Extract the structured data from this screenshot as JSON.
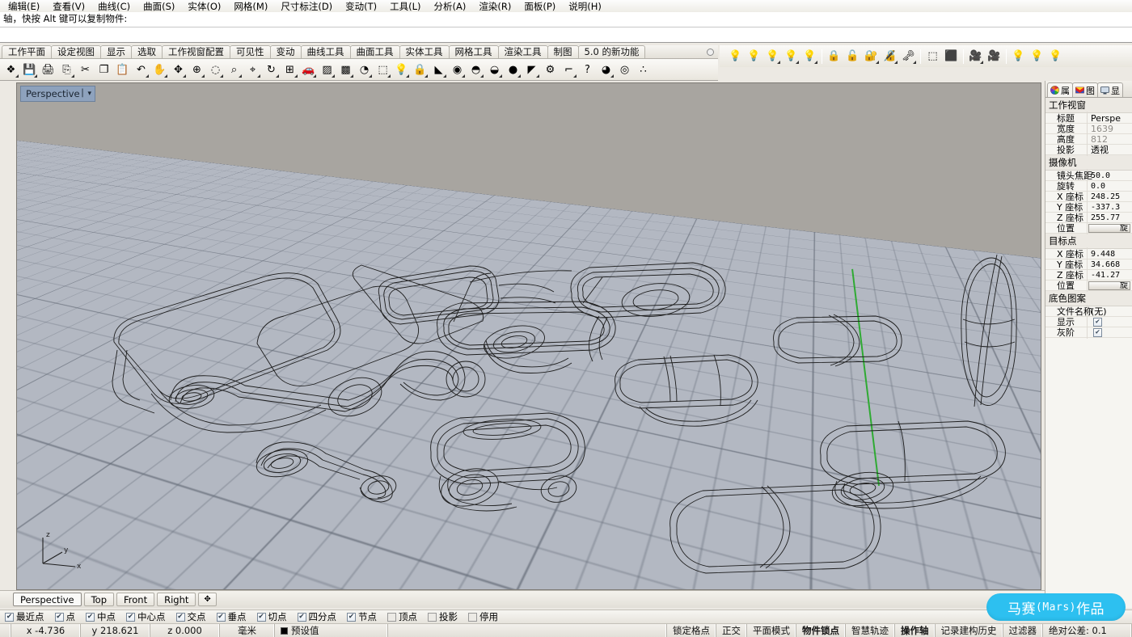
{
  "menu": {
    "items": [
      {
        "label": "编辑(E)"
      },
      {
        "label": "查看(V)"
      },
      {
        "label": "曲线(C)"
      },
      {
        "label": "曲面(S)"
      },
      {
        "label": "实体(O)"
      },
      {
        "label": "网格(M)"
      },
      {
        "label": "尺寸标注(D)"
      },
      {
        "label": "变动(T)"
      },
      {
        "label": "工具(L)"
      },
      {
        "label": "分析(A)"
      },
      {
        "label": "渲染(R)"
      },
      {
        "label": "面板(P)"
      },
      {
        "label": "说明(H)"
      }
    ]
  },
  "command": {
    "history_line": "轴，快按 Alt 键可以复制物件:",
    "input_value": "",
    "placeholder": ""
  },
  "toolbar_tabs": {
    "items": [
      {
        "label": "工作平面",
        "active": false
      },
      {
        "label": "设定视图",
        "active": false
      },
      {
        "label": "显示",
        "active": false
      },
      {
        "label": "选取",
        "active": false
      },
      {
        "label": "工作视窗配置",
        "active": false
      },
      {
        "label": "可见性",
        "active": false
      },
      {
        "label": "变动",
        "active": false
      },
      {
        "label": "曲线工具",
        "active": false
      },
      {
        "label": "曲面工具",
        "active": false
      },
      {
        "label": "实体工具",
        "active": false
      },
      {
        "label": "网格工具",
        "active": false
      },
      {
        "label": "渲染工具",
        "active": false
      },
      {
        "label": "制图",
        "active": false
      },
      {
        "label": "5.0 的新功能",
        "active": false
      }
    ]
  },
  "main_toolbar": {
    "icons": [
      {
        "name": "new-file-icon",
        "glyph": "❖",
        "flyout": true
      },
      {
        "name": "save-icon",
        "glyph": "💾",
        "flyout": true
      },
      {
        "name": "print-icon",
        "glyph": "🖨",
        "flyout": false
      },
      {
        "name": "cut-clipboard-icon",
        "glyph": "⎘",
        "flyout": true
      },
      {
        "name": "scissors-cut-icon",
        "glyph": "✂",
        "flyout": false
      },
      {
        "name": "copy-icon",
        "glyph": "❐",
        "flyout": false
      },
      {
        "name": "paste-icon",
        "glyph": "📋",
        "flyout": false
      },
      {
        "name": "undo-icon",
        "glyph": "↶",
        "flyout": true
      },
      {
        "name": "pan-hand-icon",
        "glyph": "✋",
        "flyout": true
      },
      {
        "name": "move-arrows-icon",
        "glyph": "✥",
        "flyout": true
      },
      {
        "name": "zoom-in-icon",
        "glyph": "⊕",
        "flyout": true
      },
      {
        "name": "zoom-selected-icon",
        "glyph": "◌",
        "flyout": true
      },
      {
        "name": "zoom-window-icon",
        "glyph": "⌕",
        "flyout": true
      },
      {
        "name": "zoom-extents-icon",
        "glyph": "⌖",
        "flyout": true
      },
      {
        "name": "rotate-view-icon",
        "glyph": "↻",
        "flyout": true
      },
      {
        "name": "grid-icon",
        "glyph": "⊞",
        "flyout": true
      },
      {
        "name": "render-car-icon",
        "glyph": "🚗",
        "flyout": true
      },
      {
        "name": "render-preview-icon",
        "glyph": "▨",
        "flyout": true
      },
      {
        "name": "render-props-icon",
        "glyph": "▩",
        "flyout": true
      },
      {
        "name": "analyze-circle-icon",
        "glyph": "◔",
        "flyout": true
      },
      {
        "name": "point-edit-icon",
        "glyph": "⬚",
        "flyout": true
      },
      {
        "name": "light-bulb-icon",
        "glyph": "💡",
        "flyout": true
      },
      {
        "name": "lock-icon",
        "glyph": "🔒",
        "flyout": true
      },
      {
        "name": "layer-color-icon",
        "glyph": "◣",
        "flyout": true
      },
      {
        "name": "color-wheel-icon",
        "glyph": "◉",
        "flyout": true
      },
      {
        "name": "shade-sphere-icon",
        "glyph": "◓",
        "flyout": true
      },
      {
        "name": "ghost-sphere-icon",
        "glyph": "◒",
        "flyout": true
      },
      {
        "name": "render-sphere-icon",
        "glyph": "●",
        "flyout": true
      },
      {
        "name": "flamingo-icon",
        "glyph": "◤",
        "flyout": true
      },
      {
        "name": "settings-gear-icon",
        "glyph": "⚙",
        "flyout": false
      },
      {
        "name": "dimension-icon",
        "glyph": "⌐",
        "flyout": true
      },
      {
        "name": "help-icon",
        "glyph": "?",
        "flyout": false
      },
      {
        "name": "render-blue-sphere-icon",
        "glyph": "◕",
        "flyout": true
      },
      {
        "name": "spiral-icon",
        "glyph": "◎",
        "flyout": false
      },
      {
        "name": "particles-icon",
        "glyph": "∴",
        "flyout": false
      }
    ]
  },
  "right_toolbar": {
    "icons": [
      {
        "name": "light-off-icon",
        "glyph": "💡",
        "flyout": false
      },
      {
        "name": "light-on-icon",
        "glyph": "💡",
        "flyout": false
      },
      {
        "name": "light-new-icon",
        "glyph": "💡",
        "flyout": true
      },
      {
        "name": "light-edit-icon",
        "glyph": "💡",
        "flyout": true
      },
      {
        "name": "light-pair-icon",
        "glyph": "💡",
        "flyout": true
      },
      {
        "name": "lock-closed-icon",
        "glyph": "🔒",
        "flyout": false
      },
      {
        "name": "lock-open-icon",
        "glyph": "🔓",
        "flyout": false
      },
      {
        "name": "lock-yellow-icon",
        "glyph": "🔐",
        "flyout": true
      },
      {
        "name": "lock-edit-icon",
        "glyph": "🔏",
        "flyout": true
      },
      {
        "name": "lock-pair-icon",
        "glyph": "🗝",
        "flyout": true
      },
      {
        "name": "control-points-on-icon",
        "glyph": "⬚",
        "flyout": false
      },
      {
        "name": "control-points-off-icon",
        "glyph": "⬛",
        "flyout": false
      },
      {
        "name": "camera-show-icon",
        "glyph": "🎥",
        "flyout": true
      },
      {
        "name": "camera-hide-icon",
        "glyph": "🎥",
        "flyout": false
      },
      {
        "name": "light-dim-1-icon",
        "glyph": "💡",
        "flyout": false
      },
      {
        "name": "light-dim-2-icon",
        "glyph": "💡",
        "flyout": false
      },
      {
        "name": "light-dim-3-icon",
        "glyph": "💡",
        "flyout": false
      }
    ]
  },
  "viewport": {
    "title": "Perspective",
    "axis": {
      "x": "x",
      "y": "y",
      "z": "z"
    },
    "tabs": [
      {
        "label": "Perspective",
        "active": true
      },
      {
        "label": "Top",
        "active": false
      },
      {
        "label": "Front",
        "active": false
      },
      {
        "label": "Right",
        "active": false
      },
      {
        "label": "✥",
        "active": false
      }
    ],
    "colors": {
      "sky": "#a8a5a0",
      "ground": "#b3b8c2",
      "grid_line": "#69707c",
      "x_axis": "#c33a34",
      "y_axis": "#2faa33",
      "wire": "#1a1a1a"
    }
  },
  "properties_panel": {
    "tabs": [
      {
        "label": "属",
        "icon": "color-wheel-icon",
        "active": true
      },
      {
        "label": "图",
        "icon": "layers-icon",
        "active": false
      },
      {
        "label": "显",
        "icon": "display-icon",
        "active": false
      }
    ],
    "sections": [
      {
        "title": "工作视窗",
        "rows": [
          {
            "label": "标题",
            "value": "Perspe",
            "type": "text",
            "grey": false
          },
          {
            "label": "宽度",
            "value": "1639",
            "type": "text",
            "grey": true
          },
          {
            "label": "高度",
            "value": "812",
            "type": "text",
            "grey": true
          },
          {
            "label": "投影",
            "value": "透视",
            "type": "text",
            "grey": false
          }
        ]
      },
      {
        "title": "摄像机",
        "rows": [
          {
            "label": "镜头焦距",
            "value": "50.0",
            "type": "num",
            "grey": false
          },
          {
            "label": "旋转",
            "value": "0.0",
            "type": "num",
            "grey": false
          },
          {
            "label": "X 座标",
            "value": "248.25",
            "type": "num",
            "grey": false
          },
          {
            "label": "Y 座标",
            "value": "-337.3",
            "type": "num",
            "grey": false
          },
          {
            "label": "Z 座标",
            "value": "255.77",
            "type": "num",
            "grey": false
          },
          {
            "label": "位置",
            "value": "旋",
            "type": "button",
            "grey": false
          }
        ]
      },
      {
        "title": "目标点",
        "rows": [
          {
            "label": "X 座标",
            "value": "9.448",
            "type": "num",
            "grey": false
          },
          {
            "label": "Y 座标",
            "value": "34.668",
            "type": "num",
            "grey": false
          },
          {
            "label": "Z 座标",
            "value": "-41.27",
            "type": "num",
            "grey": false
          },
          {
            "label": "位置",
            "value": "旋",
            "type": "button",
            "grey": false
          }
        ]
      },
      {
        "title": "底色图案",
        "rows": [
          {
            "label": "文件名称",
            "value": "(无)",
            "type": "text",
            "grey": false
          },
          {
            "label": "显示",
            "value": "✔",
            "type": "check",
            "grey": false
          },
          {
            "label": "灰阶",
            "value": "✔",
            "type": "check",
            "grey": false
          }
        ]
      }
    ]
  },
  "osnap": {
    "items": [
      {
        "label": "最近点",
        "checked": true
      },
      {
        "label": "点",
        "checked": true
      },
      {
        "label": "中点",
        "checked": true
      },
      {
        "label": "中心点",
        "checked": true
      },
      {
        "label": "交点",
        "checked": true
      },
      {
        "label": "垂点",
        "checked": true
      },
      {
        "label": "切点",
        "checked": true
      },
      {
        "label": "四分点",
        "checked": true
      },
      {
        "label": "节点",
        "checked": true
      },
      {
        "label": "顶点",
        "checked": false
      },
      {
        "label": "投影",
        "checked": false
      },
      {
        "label": "停用",
        "checked": false
      }
    ]
  },
  "status_bar": {
    "coords": {
      "x": "x -4.736",
      "y": "y 218.621",
      "z": "z 0.000"
    },
    "units": "毫米",
    "layer": "预设值",
    "layer_color": "#000000",
    "toggles": [
      {
        "label": "锁定格点",
        "bold": false
      },
      {
        "label": "正交",
        "bold": false
      },
      {
        "label": "平面模式",
        "bold": false
      },
      {
        "label": "物件锁点",
        "bold": true
      },
      {
        "label": "智慧轨迹",
        "bold": false
      },
      {
        "label": "操作轴",
        "bold": true
      },
      {
        "label": "记录建构历史",
        "bold": false
      },
      {
        "label": "过滤器",
        "bold": false
      }
    ],
    "tolerance": "绝对公差: 0.1"
  },
  "watermark": {
    "cjk_prefix": "马赛",
    "latin": "(Mars)",
    "cjk_suffix": "作品",
    "color": "#2dc0f0"
  }
}
